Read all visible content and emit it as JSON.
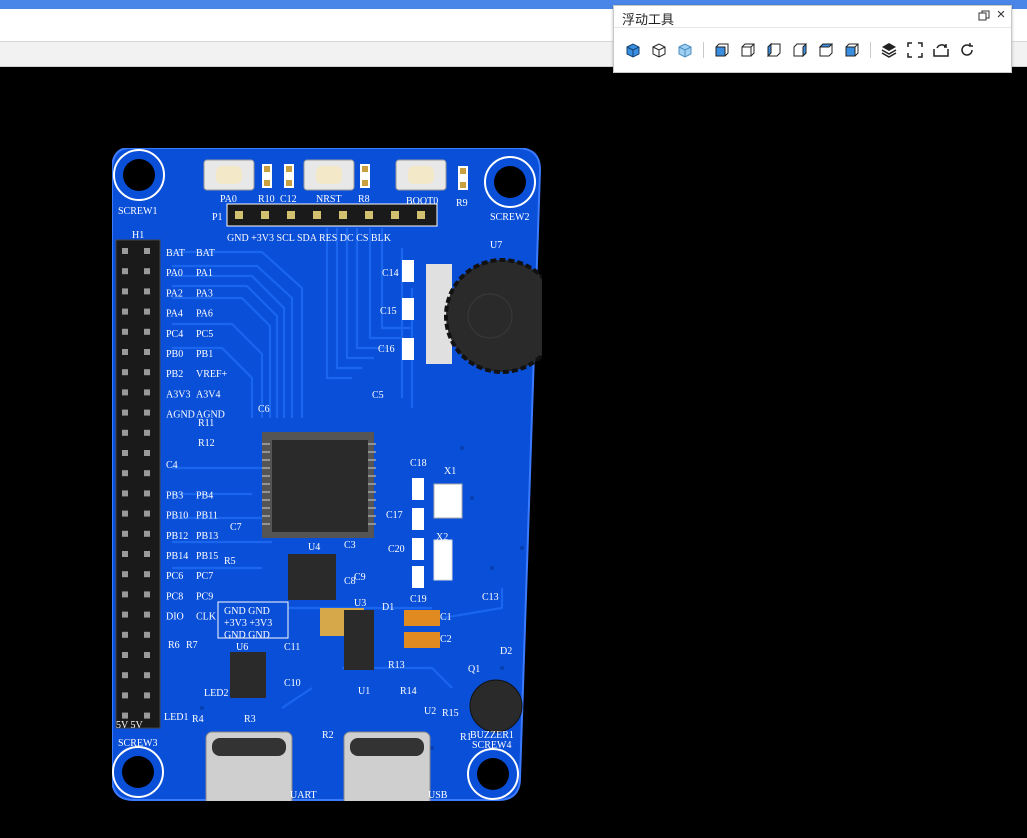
{
  "floating_toolbar": {
    "title": "浮动工具",
    "restore_icon": "restore-window-icon",
    "close_icon": "close-icon",
    "tools": [
      {
        "name": "view-iso-shaded-icon"
      },
      {
        "name": "view-iso-wire-icon"
      },
      {
        "name": "view-iso-transparent-icon"
      },
      {
        "name": "view-front-icon"
      },
      {
        "name": "view-back-icon"
      },
      {
        "name": "view-left-icon"
      },
      {
        "name": "view-right-icon"
      },
      {
        "name": "view-top-icon"
      },
      {
        "name": "view-bottom-icon"
      },
      {
        "name": "layers-icon"
      },
      {
        "name": "fit-view-icon"
      },
      {
        "name": "flip-board-icon"
      },
      {
        "name": "refresh-icon"
      }
    ]
  },
  "pcb": {
    "colors": {
      "board": "#0a4fd8",
      "silk": "#ffffff",
      "pad": "#c8a040"
    },
    "silkscreen": {
      "screw1": "SCREW1",
      "screw2": "SCREW2",
      "screw3": "SCREW3",
      "screw4": "SCREW4",
      "h1": "H1",
      "p1": "P1",
      "u7": "U7",
      "buttons": [
        "PA0",
        "NRST",
        "BOOT0"
      ],
      "top_refs": [
        "R10",
        "C12",
        "R8",
        "R9"
      ],
      "p1_pins": "GND +3V3 SCL SDA RES DC CS BLK",
      "header_left": [
        "BAT",
        "PA0",
        "PA2",
        "PA4",
        "PC4",
        "PB0",
        "PB2",
        "A3V3",
        "AGND",
        "",
        "",
        "",
        "PB3",
        "PB10",
        "PB12",
        "PB14",
        "PC6",
        "PC8",
        "DIO",
        "",
        "",
        "",
        "",
        ""
      ],
      "header_right": [
        "BAT",
        "PA1",
        "PA3",
        "PA6",
        "PC5",
        "PB1",
        "VREF+",
        "A3V4",
        "AGND",
        "",
        "",
        "",
        "PB4",
        "PB11",
        "PB13",
        "PB15",
        "PC7",
        "PC9",
        "CLK",
        "",
        "",
        "",
        "",
        ""
      ],
      "gnd_block": [
        "GND GND",
        "+3V3 +3V3",
        "GND GND"
      ],
      "refs_mid": [
        "C6",
        "C5",
        "R11",
        "R12",
        "C4",
        "C18",
        "X1",
        "C17",
        "C7",
        "C3",
        "C20",
        "X2",
        "R5",
        "U4",
        "C8",
        "C9",
        "D1",
        "C19",
        "C13",
        "U3",
        "C1",
        "C2",
        "R13",
        "Q1",
        "D2",
        "C14",
        "C15",
        "C16"
      ],
      "refs_bottom": [
        "R6",
        "R7",
        "U6",
        "C11",
        "C10",
        "LED2",
        "LED1",
        "U1",
        "R14",
        "U2",
        "R15",
        "R4",
        "R3",
        "R2",
        "R1",
        "BUZZER1",
        "UART",
        "USB",
        "5V 5V"
      ]
    }
  }
}
